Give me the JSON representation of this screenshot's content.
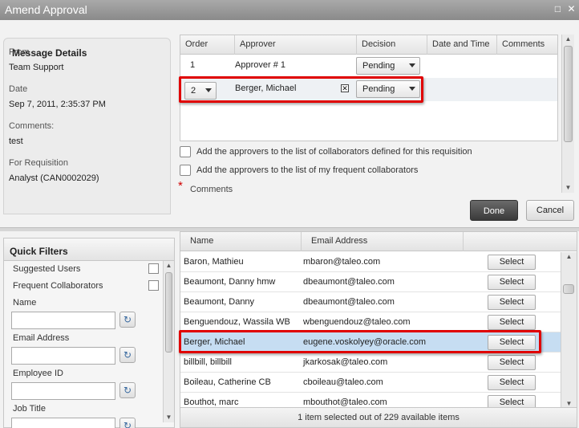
{
  "window": {
    "title": "Amend Approval"
  },
  "message_details": {
    "heading": "Message Details",
    "from_label": "From",
    "from_value": "Team Support",
    "date_label": "Date",
    "date_value": "Sep 7, 2011, 2:35:37 PM",
    "comments_label": "Comments:",
    "comments_value": "test",
    "requisition_label": "For Requisition",
    "requisition_value": "Analyst (CAN0002029)"
  },
  "approvers": {
    "columns": [
      "Order",
      "Approver",
      "Decision",
      "Date and Time",
      "Comments"
    ],
    "rows": [
      {
        "order": "1",
        "approver": "Approver # 1",
        "decision": "Pending"
      },
      {
        "order": "2",
        "approver": "Berger, Michael",
        "decision": "Pending"
      }
    ]
  },
  "options": {
    "add_requisition_collaborators": "Add the approvers to the list of collaborators defined for this requisition",
    "add_frequent_collaborators": "Add the approvers to the list of my frequent collaborators",
    "required_mark": "*",
    "comments_label": "Comments"
  },
  "buttons": {
    "done": "Done",
    "cancel": "Cancel"
  },
  "quick_filters": {
    "title": "Quick Filters",
    "suggested_users": "Suggested Users",
    "frequent_collaborators": "Frequent Collaborators",
    "name_label": "Name",
    "email_label": "Email Address",
    "employee_id_label": "Employee ID",
    "job_title_label": "Job Title"
  },
  "users": {
    "columns": [
      "Name",
      "Email Address"
    ],
    "select_label": "Select",
    "rows": [
      {
        "name": "Baron, Mathieu",
        "email": "mbaron@taleo.com"
      },
      {
        "name": "Beaumont, Danny hmw",
        "email": "dbeaumont@taleo.com"
      },
      {
        "name": "Beaumont, Danny",
        "email": "dbeaumont@taleo.com"
      },
      {
        "name": "Benguendouz, Wassila WB",
        "email": "wbenguendouz@taleo.com"
      },
      {
        "name": "Berger, Michael",
        "email": "eugene.voskolyey@oracle.com"
      },
      {
        "name": "billbill, billbill",
        "email": "jkarkosak@taleo.com"
      },
      {
        "name": "Boileau, Catherine CB",
        "email": "cboileau@taleo.com"
      },
      {
        "name": "Bouthot, marc",
        "email": "mbouthot@taleo.com"
      }
    ],
    "selected_index": 4,
    "footer": "1 item selected out of 229 available items"
  },
  "colors": {
    "highlight": "#e00000",
    "selected_row": "#c6ddf2",
    "required": "#d00000"
  }
}
